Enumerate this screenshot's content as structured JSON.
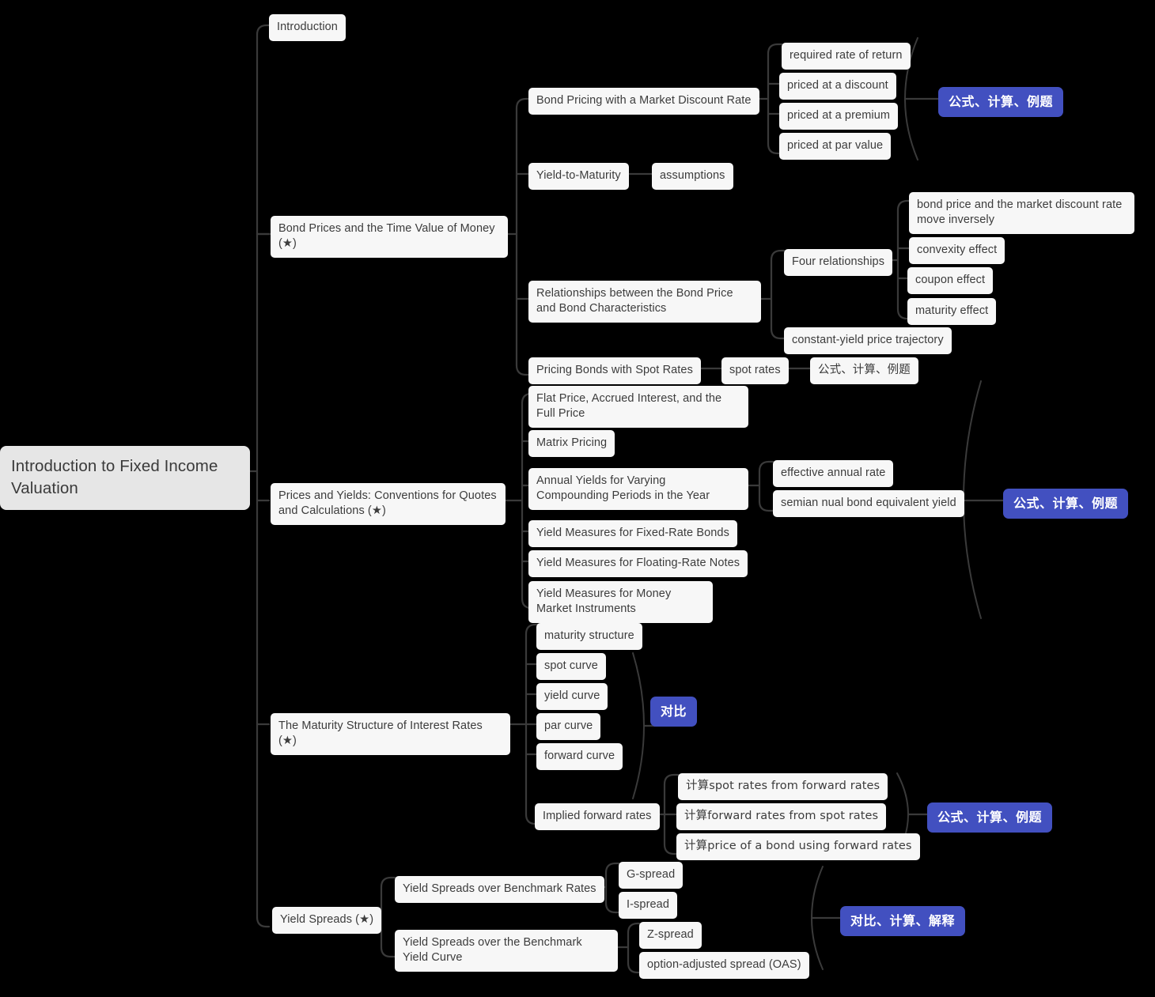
{
  "title": "Introduction to Fixed Income Valuation",
  "colors": {
    "background": "#000000",
    "node_bg": "#f7f7f7",
    "root_bg": "#e6e6e6",
    "node_text": "#3c3c3c",
    "badge_bg": "#4250c0",
    "badge_text": "#ffffff",
    "link": "#3a3a3a"
  },
  "root": {
    "label": "Introduction to Fixed Income Valuation"
  },
  "branches": {
    "introduction": {
      "label": "Introduction"
    },
    "bond_prices": {
      "label": "Bond Prices and the Time Value of Money (★)",
      "children": {
        "bond_pricing": {
          "label": "Bond Pricing with a Market Discount Rate",
          "children": [
            "required rate of return",
            "priced at a discount",
            "priced at a premium",
            "priced at par value"
          ],
          "badge": "公式、计算、例题"
        },
        "ytm": {
          "label": "Yield-to-Maturity",
          "children": [
            "assumptions"
          ]
        },
        "relationships": {
          "label": "Relationships between the Bond Price and Bond Characteristics",
          "children": {
            "four": {
              "label": "Four relationships",
              "children": [
                "bond price and the market discount rate move inversely",
                "convexity effect",
                "coupon effect",
                "maturity effect"
              ]
            },
            "trajectory": {
              "label": "constant-yield price trajectory"
            }
          }
        },
        "spot": {
          "label": "Pricing Bonds with Spot Rates",
          "children": [
            "spot rates",
            "公式、计算、例题"
          ]
        }
      }
    },
    "prices_yields": {
      "label": "Prices and Yields: Conventions for Quotes and Calculations (★)",
      "children": [
        {
          "label": "Flat Price, Accrued Interest, and the Full Price"
        },
        {
          "label": "Matrix Pricing"
        },
        {
          "label": "Annual Yields for Varying Compounding Periods in the Year",
          "children": [
            "effective annual rate",
            "semian nual bond equivalent yield"
          ]
        },
        {
          "label": "Yield Measures for Fixed-Rate Bonds"
        },
        {
          "label": "Yield Measures for Floating-Rate Notes"
        },
        {
          "label": "Yield Measures for Money Market Instruments"
        }
      ],
      "badge": "公式、计算、例题"
    },
    "maturity_structure": {
      "label": "The Maturity Structure of Interest Rates (★)",
      "children": [
        {
          "label": "maturity structure"
        },
        {
          "label": "spot curve"
        },
        {
          "label": "yield curve"
        },
        {
          "label": "par curve"
        },
        {
          "label": "forward curve"
        },
        {
          "label": "Implied forward rates",
          "children": [
            "计算spot rates from forward rates",
            "计算forward rates from spot rates",
            "计算price of a bond using forward rates"
          ],
          "badge": "公式、计算、例题"
        }
      ],
      "curve_badge": "对比"
    },
    "yield_spreads": {
      "label": "Yield Spreads (★)",
      "children": [
        {
          "label": "Yield Spreads over Benchmark Rates",
          "children": [
            "G-spread",
            "I-spread"
          ]
        },
        {
          "label": "Yield Spreads over the Benchmark Yield Curve",
          "children": [
            "Z-spread",
            "option-adjusted spread (OAS)"
          ]
        }
      ],
      "badge": "对比、计算、解释"
    }
  }
}
